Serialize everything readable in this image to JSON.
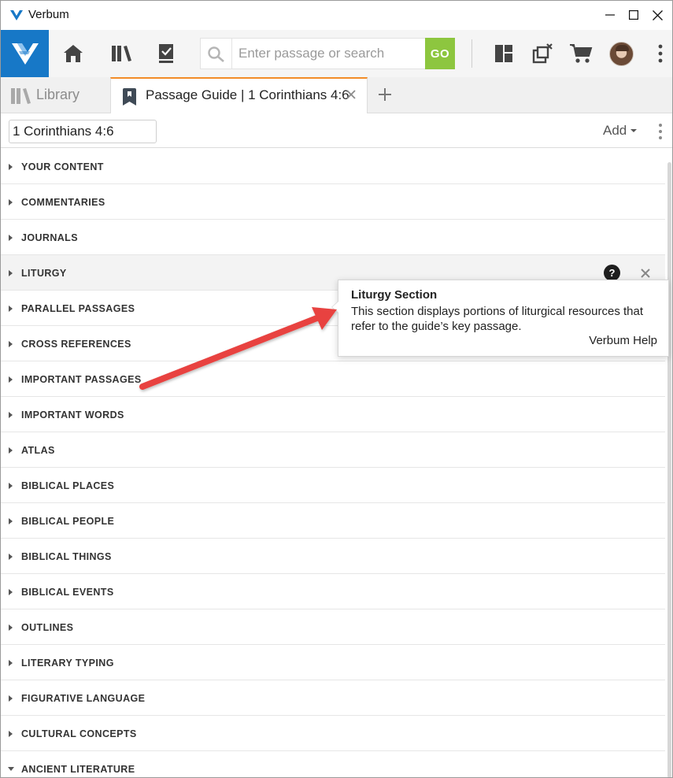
{
  "window": {
    "title": "Verbum"
  },
  "search": {
    "placeholder": "Enter passage or search",
    "go_label": "GO"
  },
  "tabs": [
    {
      "label": "Library",
      "active": false
    },
    {
      "label": "Passage Guide | 1 Corinthians 4:6",
      "active": true
    }
  ],
  "panel": {
    "reference_value": "1 Corinthians 4:6",
    "add_label": "Add"
  },
  "sections": [
    {
      "label": "YOUR CONTENT"
    },
    {
      "label": "COMMENTARIES"
    },
    {
      "label": "JOURNALS"
    },
    {
      "label": "LITURGY",
      "highlighted": true
    },
    {
      "label": "PARALLEL PASSAGES"
    },
    {
      "label": "CROSS REFERENCES"
    },
    {
      "label": "IMPORTANT PASSAGES"
    },
    {
      "label": "IMPORTANT WORDS"
    },
    {
      "label": "ATLAS"
    },
    {
      "label": "BIBLICAL PLACES"
    },
    {
      "label": "BIBLICAL PEOPLE"
    },
    {
      "label": "BIBLICAL THINGS"
    },
    {
      "label": "BIBLICAL EVENTS"
    },
    {
      "label": "OUTLINES"
    },
    {
      "label": "LITERARY TYPING"
    },
    {
      "label": "FIGURATIVE LANGUAGE"
    },
    {
      "label": "CULTURAL CONCEPTS"
    },
    {
      "label": "ANCIENT LITERATURE"
    }
  ],
  "liturgy_help_glyph": "?",
  "tooltip": {
    "title": "Liturgy Section",
    "body": "This section displays portions of liturgical resources that refer to the guide’s key passage.",
    "link": "Verbum Help"
  },
  "colors": {
    "brand_blue": "#1778c7",
    "go_green": "#8dc63f",
    "active_tab_accent": "#f28c28",
    "annotation_arrow": "#e8423f"
  },
  "icons": {
    "toolbar": [
      "verbum-logo-icon",
      "home-icon",
      "library-icon",
      "tasks-icon",
      "search-icon",
      "layouts-icon",
      "close-panels-icon",
      "cart-icon",
      "avatar",
      "more-vertical-icon"
    ]
  }
}
